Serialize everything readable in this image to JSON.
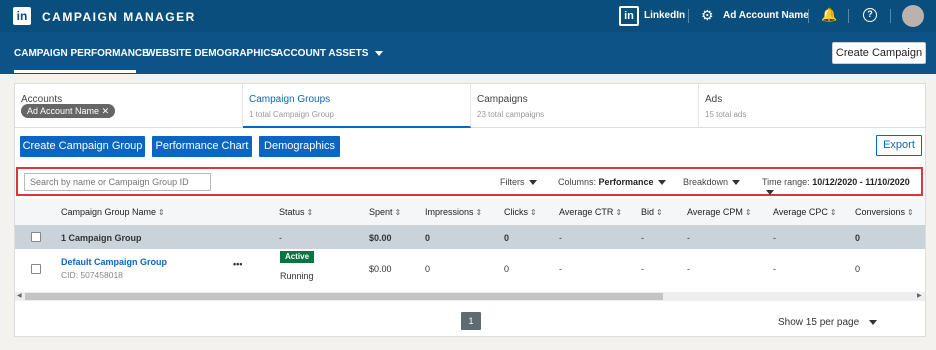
{
  "app": {
    "logo": "in",
    "title": "CAMPAIGN MANAGER"
  },
  "topbar": {
    "linkedin_logo": "in",
    "linkedin_label": "LinkedIn",
    "account_label": "Ad Account Name",
    "icons": {
      "gear": "⚙",
      "bell": "🔔",
      "help": "?"
    }
  },
  "nav": {
    "items": [
      "CAMPAIGN PERFORMANCE",
      "WEBSITE DEMOGRAPHICS",
      "ACCOUNT ASSETS"
    ],
    "create_label": "Create Campaign"
  },
  "tabs": [
    {
      "title": "Accounts",
      "chip": "Ad Account Name"
    },
    {
      "title": "Campaign Groups",
      "sub": "1 total Campaign Group"
    },
    {
      "title": "Campaigns",
      "sub": "23 total campaigns"
    },
    {
      "title": "Ads",
      "sub": "15 total ads"
    }
  ],
  "actions": {
    "create_group": "Create Campaign Group",
    "perf_chart": "Performance Chart",
    "demographics": "Demographics",
    "export": "Export"
  },
  "filters": {
    "search_placeholder": "Search by name or Campaign Group ID",
    "filters": "Filters",
    "columns_label": "Columns:",
    "columns_value": "Performance",
    "breakdown": "Breakdown",
    "time_label": "Time range:",
    "time_value": "10/12/2020 - 11/10/2020"
  },
  "table": {
    "headers": [
      "Campaign Group Name",
      "Status",
      "Spent",
      "Impressions",
      "Clicks",
      "Average CTR",
      "Bid",
      "Average CPM",
      "Average CPC",
      "Conversions"
    ],
    "total_row": {
      "name": "1 Campaign Group",
      "status": "-",
      "spent": "$0.00",
      "impressions": "0",
      "clicks": "0",
      "ctr": "-",
      "bid": "-",
      "cpm": "-",
      "cpc": "-",
      "conversions": "0"
    },
    "rows": [
      {
        "name": "Default Campaign Group",
        "cid": "CID: 507458018",
        "more": "•••",
        "badge": "Active",
        "status": "Running",
        "spent": "$0.00",
        "impressions": "0",
        "clicks": "0",
        "ctr": "-",
        "bid": "-",
        "cpm": "-",
        "cpc": "-",
        "conversions": "0"
      }
    ]
  },
  "pagination": {
    "page": "1",
    "per_page": "Show 15 per page"
  },
  "colors": {
    "topbar": "#0a4e7e",
    "navbar": "#0d5388",
    "primary": "#0a66c2",
    "active_badge": "#057642",
    "highlight_border": "#d9363e"
  }
}
